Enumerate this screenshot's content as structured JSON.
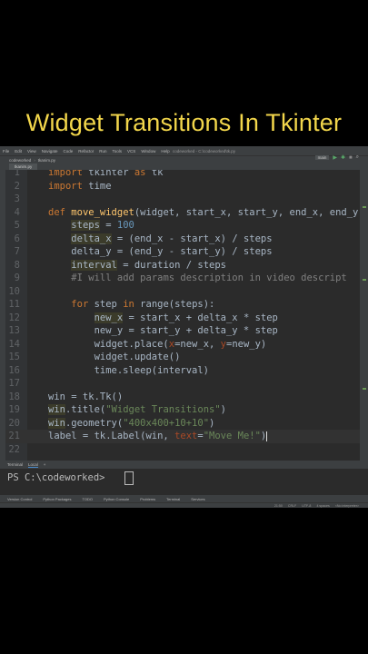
{
  "headline": "Widget Transitions In Tkinter",
  "menubar": {
    "items": [
      "File",
      "Edit",
      "View",
      "Navigate",
      "Code",
      "Refactor",
      "Run",
      "Tools",
      "VCS",
      "Window",
      "Help"
    ],
    "title": "codeworked - C:\\codeworked\\tk.py"
  },
  "navbar": {
    "project": "codeworked",
    "file": "tkanim.py"
  },
  "run_config": "main",
  "tab": {
    "label": "tkanim.py"
  },
  "code_lines": [
    {
      "n": "1",
      "html": "<span class=\"kw\">import</span> tkinter <span class=\"kw\">as</span> tk"
    },
    {
      "n": "2",
      "html": "<span class=\"kw\">import</span> time"
    },
    {
      "n": "3",
      "html": ""
    },
    {
      "n": "4",
      "html": "<span class=\"kw\">def</span> <span class=\"fn\">move_widget</span>(widget, start_x, start_y, end_x, end_y"
    },
    {
      "n": "5",
      "html": "    <span class=\"hl\">steps</span> = <span class=\"num\">100</span>"
    },
    {
      "n": "6",
      "html": "    <span class=\"hl\">delta_x</span> = (end_x - start_x) / steps"
    },
    {
      "n": "7",
      "html": "    delta_y = (end_y - start_y) / steps"
    },
    {
      "n": "8",
      "html": "    <span class=\"hl\">interval</span> = duration / steps"
    },
    {
      "n": "9",
      "html": "    <span class=\"cm\">#I will add params description in video descript</span>"
    },
    {
      "n": "10",
      "html": ""
    },
    {
      "n": "11",
      "html": "    <span class=\"kw\">for</span> step <span class=\"kw\">in</span> range(steps):"
    },
    {
      "n": "12",
      "html": "        <span class=\"hl\">new_x</span> = start_x + delta_x * step"
    },
    {
      "n": "13",
      "html": "        new_y = start_y + delta_y * step"
    },
    {
      "n": "14",
      "html": "        widget.place(<span class=\"param\">x</span>=new_x, <span class=\"param\">y</span>=new_y)"
    },
    {
      "n": "15",
      "html": "        widget.update()"
    },
    {
      "n": "16",
      "html": "        time.sleep(interval)"
    },
    {
      "n": "17",
      "html": ""
    },
    {
      "n": "18",
      "html": "win = tk.Tk()"
    },
    {
      "n": "19",
      "html": "<span class=\"hl\">win</span>.title(<span class=\"str\">\"Widget Transitions\"</span>)"
    },
    {
      "n": "20",
      "html": "<span class=\"hl\">win</span>.geometry(<span class=\"str\">\"400x400+10+10\"</span>)"
    },
    {
      "n": "21",
      "html": "label = tk.Label(win, <span class=\"param\">text</span>=<span class=\"str\">\"Move Me!\"</span>)<span class=\"caret\"></span>"
    },
    {
      "n": "22",
      "html": ""
    }
  ],
  "terminal": {
    "tabs": [
      "Terminal",
      "Local",
      "+"
    ],
    "prompt": "PS C:\\codeworked>"
  },
  "bottom_tools": [
    "Version Control",
    "Python Packages",
    "TODO",
    "Python Console",
    "Problems",
    "Terminal",
    "Services"
  ],
  "status": [
    "21:50",
    "CRLF",
    "UTF-8",
    "4 spaces",
    "<No interpreter>"
  ],
  "colors": {
    "headline": "#f2d64b",
    "editor_bg": "#2b2b2b",
    "keyword": "#cc7832",
    "function": "#ffc66d",
    "string": "#6a8759",
    "number": "#6897bb",
    "comment": "#808080"
  }
}
